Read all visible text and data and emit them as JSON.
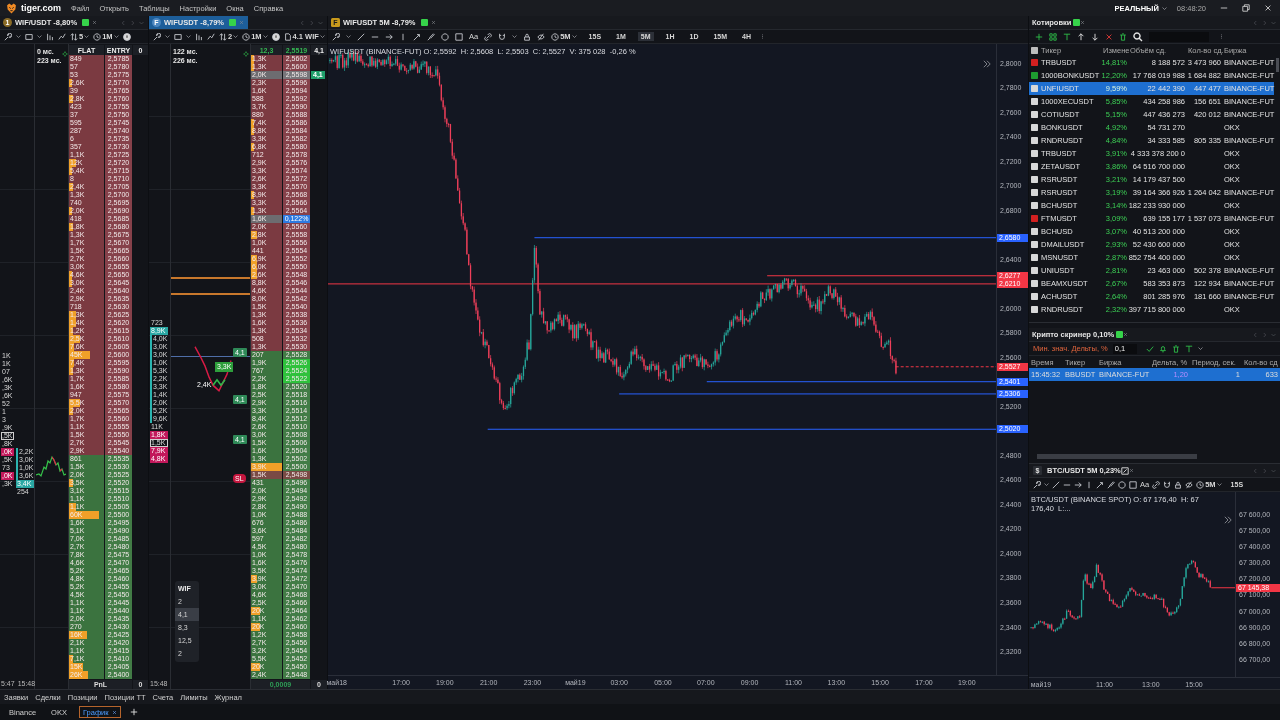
{
  "title_bar": {
    "brand": "tiger.com",
    "menu": [
      "Файл",
      "Открыть",
      "Таблицы",
      "Настройки",
      "Окна",
      "Справка"
    ],
    "account": "РЕАЛЬНЫЙ",
    "time": "08:48:20"
  },
  "order_books": [
    {
      "tab": {
        "badge": "1",
        "title": "WIF/USDT -8,80%",
        "selected": false
      },
      "toolbar": {
        "depth": "5",
        "interval": "1M"
      },
      "latency": [
        "0 мс.",
        "223 мс."
      ],
      "columns": [
        "FLAT",
        "ENTRY",
        "0"
      ],
      "side_lists": [
        {
          "items": [
            {
              "text": "1K",
              "kind": "plain"
            },
            {
              "text": "1K",
              "kind": "plain"
            },
            {
              "text": "07",
              "kind": "plain"
            },
            {
              "text": ",6K",
              "kind": "plain"
            },
            {
              "text": ",3K",
              "kind": "plain"
            },
            {
              "text": ",6K",
              "kind": "plain"
            },
            {
              "text": "52",
              "kind": "plain"
            },
            {
              "text": "1",
              "kind": "plain"
            },
            {
              "text": "3",
              "kind": "plain"
            },
            {
              "text": ",9K",
              "kind": "plain"
            },
            {
              "text": ",5K",
              "kind": "boxed"
            },
            {
              "text": ",8K",
              "kind": "plain"
            },
            {
              "text": ",0K",
              "kind": "sell"
            },
            {
              "text": ",5K",
              "kind": "plain"
            },
            {
              "text": "73",
              "kind": "plain"
            },
            {
              "text": ",0K",
              "kind": "sell"
            },
            {
              "text": ",3K",
              "kind": "plain"
            }
          ]
        },
        {
          "items": [
            {
              "text": "2,2K",
              "kind": "buy"
            },
            {
              "text": "3,0K",
              "kind": "buy"
            },
            {
              "text": "1,0K",
              "kind": "buy"
            },
            {
              "text": "3,6K",
              "kind": "buy"
            },
            {
              "text": "3,4K",
              "kind": "hit"
            }
          ],
          "footer": "254"
        }
      ],
      "rows": [
        {
          "kind": "ask",
          "volume": "849",
          "price": "2,5785"
        },
        {
          "kind": "ask",
          "volume": "57",
          "price": "2,5780"
        },
        {
          "kind": "ask",
          "volume": "53",
          "price": "2,5775"
        },
        {
          "kind": "ask",
          "volume": "2,6K",
          "price": "2,5770",
          "level": 0.08
        },
        {
          "kind": "ask",
          "volume": "39",
          "price": "2,5765"
        },
        {
          "kind": "ask",
          "volume": "2,8K",
          "price": "2,5760",
          "level": 0.12
        },
        {
          "kind": "ask",
          "volume": "423",
          "price": "2,5755"
        },
        {
          "kind": "ask",
          "volume": "37",
          "price": "2,5750"
        },
        {
          "kind": "ask",
          "volume": "595",
          "price": "2,5745"
        },
        {
          "kind": "ask",
          "volume": "287",
          "price": "2,5740"
        },
        {
          "kind": "ask",
          "volume": "6",
          "price": "2,5735"
        },
        {
          "kind": "ask",
          "volume": "357",
          "price": "2,5730"
        },
        {
          "kind": "ask",
          "volume": "1,1K",
          "price": "2,5725"
        },
        {
          "kind": "ask",
          "volume": "12K",
          "price": "2,5720",
          "level": 0.2
        },
        {
          "kind": "ask",
          "volume": "5,4K",
          "price": "2,5715",
          "level": 0.08
        },
        {
          "kind": "ask",
          "volume": "8",
          "price": "2,5710"
        },
        {
          "kind": "ask",
          "volume": "2,4K",
          "price": "2,5705",
          "level": 0.1
        },
        {
          "kind": "ask",
          "volume": "1,3K",
          "price": "2,5700"
        },
        {
          "kind": "ask",
          "volume": "740",
          "price": "2,5695"
        },
        {
          "kind": "ask",
          "volume": "2,0K",
          "price": "2,5690",
          "level": 0.08
        },
        {
          "kind": "ask",
          "volume": "418",
          "price": "2,5685"
        },
        {
          "kind": "ask",
          "volume": "1,8K",
          "price": "2,5680",
          "level": 0.1
        },
        {
          "kind": "ask",
          "volume": "1,3K",
          "price": "2,5675"
        },
        {
          "kind": "ask",
          "volume": "1,7K",
          "price": "2,5670"
        },
        {
          "kind": "ask",
          "volume": "1,5K",
          "price": "2,5665"
        },
        {
          "kind": "ask",
          "volume": "2,7K",
          "price": "2,5660"
        },
        {
          "kind": "ask",
          "volume": "3,0K",
          "price": "2,5655"
        },
        {
          "kind": "ask",
          "volume": "4,6K",
          "price": "2,5650",
          "level": 0.08
        },
        {
          "kind": "ask",
          "volume": "3,0K",
          "price": "2,5645",
          "level": 0.08
        },
        {
          "kind": "ask",
          "volume": "2,4K",
          "price": "2,5640"
        },
        {
          "kind": "ask",
          "volume": "2,9K",
          "price": "2,5635"
        },
        {
          "kind": "ask",
          "volume": "718",
          "price": "2,5630"
        },
        {
          "kind": "ask",
          "volume": "1,3K",
          "price": "2,5625",
          "level": 0.2
        },
        {
          "kind": "ask",
          "volume": "1,4K",
          "price": "2,5620",
          "level": 0.2
        },
        {
          "kind": "ask",
          "volume": "1,2K",
          "price": "2,5615",
          "level": 0.1
        },
        {
          "kind": "ask",
          "volume": "2,5K",
          "price": "2,5610",
          "level": 0.3
        },
        {
          "kind": "ask",
          "volume": "7,6K",
          "price": "2,5605",
          "level": 0.15
        },
        {
          "kind": "ask",
          "volume": "45K",
          "price": "2,5600",
          "level": 0.6
        },
        {
          "kind": "ask",
          "volume": "7,4K",
          "price": "2,5595",
          "level": 0.15
        },
        {
          "kind": "ask",
          "volume": "1,3K",
          "price": "2,5590",
          "level": 0.1
        },
        {
          "kind": "ask",
          "volume": "1,7K",
          "price": "2,5585"
        },
        {
          "kind": "ask",
          "volume": "1,6K",
          "price": "2,5580"
        },
        {
          "kind": "ask",
          "volume": "947",
          "price": "2,5575"
        },
        {
          "kind": "ask",
          "volume": "5,5K",
          "price": "2,5570",
          "level": 0.3
        },
        {
          "kind": "ask",
          "volume": "2,0K",
          "price": "2,5565",
          "level": 0.1
        },
        {
          "kind": "ask",
          "volume": "1,7K",
          "price": "2,5560"
        },
        {
          "kind": "ask",
          "volume": "1,1K",
          "price": "2,5555"
        },
        {
          "kind": "ask",
          "volume": "1,5K",
          "price": "2,5550"
        },
        {
          "kind": "ask",
          "volume": "2,7K",
          "price": "2,5545"
        },
        {
          "kind": "ask",
          "volume": "2,9K",
          "price": "2,5540"
        },
        {
          "kind": "bid",
          "volume": "861",
          "price": "2,5535"
        },
        {
          "kind": "bid",
          "volume": "1,5K",
          "price": "2,5530"
        },
        {
          "kind": "bid",
          "volume": "2,0K",
          "price": "2,5525"
        },
        {
          "kind": "bid",
          "volume": "3,5K",
          "price": "2,5520",
          "level": 0.1
        },
        {
          "kind": "bid",
          "volume": "3,1K",
          "price": "2,5515"
        },
        {
          "kind": "bid",
          "volume": "1,1K",
          "price": "2,5510"
        },
        {
          "kind": "bid",
          "volume": "1,1K",
          "price": "2,5505",
          "level": 0.2
        },
        {
          "kind": "bid",
          "volume": "60K",
          "price": "2,5500",
          "level": 0.85
        },
        {
          "kind": "bid",
          "volume": "1,6K",
          "price": "2,5495"
        },
        {
          "kind": "bid",
          "volume": "5,1K",
          "price": "2,5490"
        },
        {
          "kind": "bid",
          "volume": "7,0K",
          "price": "2,5485"
        },
        {
          "kind": "bid",
          "volume": "2,7K",
          "price": "2,5480"
        },
        {
          "kind": "bid",
          "volume": "7,8K",
          "price": "2,5475"
        },
        {
          "kind": "bid",
          "volume": "4,6K",
          "price": "2,5470"
        },
        {
          "kind": "bid",
          "volume": "5,2K",
          "price": "2,5465"
        },
        {
          "kind": "bid",
          "volume": "4,8K",
          "price": "2,5460"
        },
        {
          "kind": "bid",
          "volume": "5,2K",
          "price": "2,5455"
        },
        {
          "kind": "bid",
          "volume": "4,5K",
          "price": "2,5450"
        },
        {
          "kind": "bid",
          "volume": "1,1K",
          "price": "2,5445"
        },
        {
          "kind": "bid",
          "volume": "1,1K",
          "price": "2,5440"
        },
        {
          "kind": "bid",
          "volume": "2,0K",
          "price": "2,5435"
        },
        {
          "kind": "bid",
          "volume": "270",
          "price": "2,5430"
        },
        {
          "kind": "bid",
          "volume": "16K",
          "price": "2,5425",
          "level": 0.5
        },
        {
          "kind": "bid",
          "volume": "2,1K",
          "price": "2,5420"
        },
        {
          "kind": "bid",
          "volume": "1,1K",
          "price": "2,5415"
        },
        {
          "kind": "bid",
          "volume": "7,1K",
          "price": "2,5410",
          "level": 0.1
        },
        {
          "kind": "bid",
          "volume": "15K",
          "price": "2,5405",
          "level": 0.4
        },
        {
          "kind": "bid",
          "volume": "26K",
          "price": "2,5400",
          "level": 0.55
        }
      ],
      "footer": {
        "times": [
          "5:47",
          "15:48"
        ],
        "cells": [
          "PnL",
          "0"
        ]
      }
    },
    {
      "tab": {
        "badge": "F",
        "title": "WIFUSDT -8,79%",
        "selected": true
      },
      "toolbar": {
        "depth": "2",
        "interval": "1M",
        "volume": "4.1 WIF"
      },
      "latency": [
        "122 мс.",
        "226 мс."
      ],
      "columns": [
        "12,3",
        "2,5519",
        "4,1"
      ],
      "side_lists": [
        {
          "items": [
            {
              "text": "723",
              "kind": "plain"
            },
            {
              "text": "8,9K",
              "kind": "hit"
            },
            {
              "text": "4,0K",
              "kind": "buy"
            },
            {
              "text": "3,0K",
              "kind": "buy"
            },
            {
              "text": "3,0K",
              "kind": "buy"
            },
            {
              "text": "1,0K",
              "kind": "buy"
            },
            {
              "text": "5,3K",
              "kind": "buy"
            },
            {
              "text": "2,2K",
              "kind": "buy"
            },
            {
              "text": "3,3K",
              "kind": "buy"
            },
            {
              "text": "1,4K",
              "kind": "buy"
            },
            {
              "text": "2,0K",
              "kind": "buy"
            },
            {
              "text": "5,2K",
              "kind": "buy"
            },
            {
              "text": "9,6K",
              "kind": "buy"
            },
            {
              "text": "11K",
              "kind": "plain"
            },
            {
              "text": "1,8K",
              "kind": "sell"
            },
            {
              "text": "1,5K",
              "kind": "boxed"
            },
            {
              "text": "7,9K",
              "kind": "sell"
            },
            {
              "text": "4,8K",
              "kind": "sell"
            }
          ]
        }
      ],
      "markers": [
        {
          "text": "4,1",
          "kind": "buy"
        },
        {
          "text": "4,1",
          "kind": "buy"
        },
        {
          "text": "4,1",
          "kind": "buy"
        },
        {
          "text": "SL",
          "kind": "stop"
        }
      ],
      "cluster": [
        {
          "text": "3,3K",
          "kind": "buy"
        },
        {
          "text": "2,4K",
          "kind": "sell"
        }
      ],
      "quick_volumes": {
        "title": "WIF",
        "values": [
          {
            "label": "2",
            "selected": false
          },
          {
            "label": "4,1",
            "selected": true
          },
          {
            "label": "8,3",
            "selected": false
          },
          {
            "label": "12,5",
            "selected": false
          },
          {
            "label": "2",
            "selected": false
          }
        ]
      },
      "rows": [
        {
          "kind": "ask",
          "volume": "1,3K",
          "price": "2,5602",
          "level": 0.1
        },
        {
          "kind": "ask",
          "volume": "1,3K",
          "price": "2,5600",
          "level": 0.1
        },
        {
          "kind": "ask",
          "volume": "2,0K",
          "price": "2,5598",
          "order": "4,1"
        },
        {
          "kind": "ask",
          "volume": "2,3K",
          "price": "2,5596"
        },
        {
          "kind": "ask",
          "volume": "1,6K",
          "price": "2,5594"
        },
        {
          "kind": "ask",
          "volume": "588",
          "price": "2,5592"
        },
        {
          "kind": "ask",
          "volume": "3,7K",
          "price": "2,5590"
        },
        {
          "kind": "ask",
          "volume": "880",
          "price": "2,5588"
        },
        {
          "kind": "ask",
          "volume": "7,4K",
          "price": "2,5586",
          "level": 0.1
        },
        {
          "kind": "ask",
          "volume": "8,8K",
          "price": "2,5584",
          "level": 0.1
        },
        {
          "kind": "ask",
          "volume": "3,3K",
          "price": "2,5582"
        },
        {
          "kind": "ask",
          "volume": "6,8K",
          "price": "2,5580",
          "level": 0.1
        },
        {
          "kind": "ask",
          "volume": "712",
          "price": "2,5578"
        },
        {
          "kind": "ask",
          "volume": "2,9K",
          "price": "2,5576"
        },
        {
          "kind": "ask",
          "volume": "3,3K",
          "price": "2,5574"
        },
        {
          "kind": "ask",
          "volume": "2,6K",
          "price": "2,5572"
        },
        {
          "kind": "ask",
          "volume": "3,3K",
          "price": "2,5570"
        },
        {
          "kind": "ask",
          "volume": "8,9K",
          "price": "2,5568",
          "level": 0.1
        },
        {
          "kind": "ask",
          "volume": "3,3K",
          "price": "2,5566"
        },
        {
          "kind": "ask",
          "volume": "1,3K",
          "price": "2,5564",
          "level": 0.1
        },
        {
          "kind": "ask",
          "volume": "1,6K",
          "tooltip": "0,122%"
        },
        {
          "kind": "ask",
          "volume": "2,0K",
          "price": "2,5560"
        },
        {
          "kind": "ask",
          "volume": "2,8K",
          "price": "2,5558",
          "level": 0.2
        },
        {
          "kind": "ask",
          "volume": "1,0K",
          "price": "2,5556"
        },
        {
          "kind": "ask",
          "volume": "441",
          "price": "2,5554"
        },
        {
          "kind": "ask",
          "volume": "6,9K",
          "price": "2,5552",
          "level": 0.2
        },
        {
          "kind": "ask",
          "volume": "6,0K",
          "price": "2,5550",
          "level": 0.2
        },
        {
          "kind": "ask",
          "volume": "2,6K",
          "price": "2,5548",
          "level": 0.2
        },
        {
          "kind": "ask",
          "volume": "8,8K",
          "price": "2,5546"
        },
        {
          "kind": "ask",
          "volume": "4,6K",
          "price": "2,5544"
        },
        {
          "kind": "ask",
          "volume": "8,0K",
          "price": "2,5542"
        },
        {
          "kind": "ask",
          "volume": "1,5K",
          "price": "2,5540"
        },
        {
          "kind": "ask",
          "volume": "1,3K",
          "price": "2,5538"
        },
        {
          "kind": "ask",
          "volume": "1,6K",
          "price": "2,5536"
        },
        {
          "kind": "ask",
          "volume": "1,3K",
          "price": "2,5534"
        },
        {
          "kind": "ask",
          "volume": "508",
          "price": "2,5532"
        },
        {
          "kind": "ask",
          "volume": "1,3K",
          "price": "2,5530"
        },
        {
          "kind": "bid",
          "volume": "207",
          "price": "2,5528"
        },
        {
          "kind": "trade",
          "volume": "1,9K",
          "price": "2,5526"
        },
        {
          "kind": "trade",
          "volume": "767",
          "price": "2,5524"
        },
        {
          "kind": "trade",
          "volume": "2,2K",
          "price": "2,5522"
        },
        {
          "kind": "bid",
          "volume": "1,8K",
          "price": "2,5520"
        },
        {
          "kind": "bid",
          "volume": "2,5K",
          "price": "2,5518"
        },
        {
          "kind": "bid",
          "volume": "2,9K",
          "price": "2,5516"
        },
        {
          "kind": "bid",
          "volume": "3,3K",
          "price": "2,5514"
        },
        {
          "kind": "bid",
          "volume": "8,4K",
          "price": "2,5512"
        },
        {
          "kind": "bid",
          "volume": "2,6K",
          "price": "2,5510"
        },
        {
          "kind": "bid",
          "volume": "3,0K",
          "price": "2,5508"
        },
        {
          "kind": "bid",
          "volume": "1,5K",
          "price": "2,5506"
        },
        {
          "kind": "bid",
          "volume": "1,6K",
          "price": "2,5504"
        },
        {
          "kind": "bid",
          "volume": "1,3K",
          "price": "2,5502"
        },
        {
          "kind": "bid",
          "volume": "3,9K",
          "price": "2,5500",
          "level": 1
        },
        {
          "kind": "stop",
          "volume": "1,5K",
          "price": "2,5498"
        },
        {
          "kind": "bid",
          "volume": "431",
          "price": "2,5496"
        },
        {
          "kind": "bid",
          "volume": "2,0K",
          "price": "2,5494"
        },
        {
          "kind": "bid",
          "volume": "2,9K",
          "price": "2,5492"
        },
        {
          "kind": "bid",
          "volume": "2,8K",
          "price": "2,5490"
        },
        {
          "kind": "bid",
          "volume": "1,0K",
          "price": "2,5488"
        },
        {
          "kind": "bid",
          "volume": "676",
          "price": "2,5486"
        },
        {
          "kind": "bid",
          "volume": "3,6K",
          "price": "2,5484"
        },
        {
          "kind": "bid",
          "volume": "597",
          "price": "2,5482"
        },
        {
          "kind": "bid",
          "volume": "4,5K",
          "price": "2,5480"
        },
        {
          "kind": "bid",
          "volume": "1,0K",
          "price": "2,5478"
        },
        {
          "kind": "bid",
          "volume": "1,6K",
          "price": "2,5476"
        },
        {
          "kind": "bid",
          "volume": "3,5K",
          "price": "2,5474"
        },
        {
          "kind": "bid",
          "volume": "3,9K",
          "price": "2,5472",
          "level": 0.2
        },
        {
          "kind": "bid",
          "volume": "3,0K",
          "price": "2,5470"
        },
        {
          "kind": "bid",
          "volume": "4,6K",
          "price": "2,5468"
        },
        {
          "kind": "bid",
          "volume": "2,5K",
          "price": "2,5466"
        },
        {
          "kind": "bid",
          "volume": "20K",
          "price": "2,5464",
          "level": 0.3
        },
        {
          "kind": "bid",
          "volume": "1,1K",
          "price": "2,5462"
        },
        {
          "kind": "bid",
          "volume": "20K",
          "price": "2,5460",
          "level": 0.3
        },
        {
          "kind": "bid",
          "volume": "1,2K",
          "price": "2,5458"
        },
        {
          "kind": "bid",
          "volume": "2,7K",
          "price": "2,5456"
        },
        {
          "kind": "bid",
          "volume": "3,2K",
          "price": "2,5454"
        },
        {
          "kind": "bid",
          "volume": "5,5K",
          "price": "2,5452"
        },
        {
          "kind": "bid",
          "volume": "20K",
          "price": "2,5450",
          "level": 0.3
        },
        {
          "kind": "bid",
          "volume": "2,4K",
          "price": "2,5448"
        }
      ],
      "footer": {
        "times": [
          "15:48"
        ],
        "cells": [
          "0,0009",
          "0"
        ]
      }
    }
  ],
  "chart": {
    "tab": {
      "badge": "F",
      "title": "WIFUSDT 5M -8,79%"
    },
    "toolbar": {
      "text_tool": "Aa",
      "interval": "5M",
      "timeframes": [
        {
          "label": "15S",
          "selected": false
        },
        {
          "label": "1M",
          "selected": false
        },
        {
          "label": "5M",
          "selected": true
        },
        {
          "label": "1H",
          "selected": false
        },
        {
          "label": "1D",
          "selected": false
        },
        {
          "label": "15M",
          "selected": false
        },
        {
          "label": "4H",
          "selected": false
        }
      ]
    },
    "legend": "WIFUSDT (BINANCE-FUT) O: 2,5592  H: 2,5608  L: 2,5503  C: 2,5527  V: 375 028  -0,26 %",
    "price_axis": [
      "2,8000",
      "2,7800",
      "2,7600",
      "2,7400",
      "2,7200",
      "2,7000",
      "2,6800",
      "2,6400",
      "2,6000",
      "2,5800",
      "2,5600",
      "2,5200",
      "2,4800",
      "2,4600",
      "2,4400",
      "2,4200",
      "2,4000",
      "2,3800",
      "2,3600",
      "2,3400",
      "2,3200"
    ],
    "price_tags": [
      {
        "label": "2,6580",
        "color": "#2962ff"
      },
      {
        "label": "2,6277",
        "color": "#f23645"
      },
      {
        "label": "2,6210",
        "color": "#f23645"
      },
      {
        "label": "2,5527",
        "color": "#f23645"
      },
      {
        "label": "2,5401",
        "color": "#2962ff"
      },
      {
        "label": "2,5306",
        "color": "#2962ff"
      },
      {
        "label": "2,5020",
        "color": "#2962ff"
      }
    ],
    "time_axis": [
      "май18",
      "17:00",
      "19:00",
      "21:00",
      "23:00",
      "май19",
      "03:00",
      "05:00",
      "07:00",
      "09:00",
      "11:00",
      "13:00",
      "15:00",
      "17:00",
      "19:00"
    ]
  },
  "quotes": {
    "title": "Котировки",
    "columns": [
      "Тикер",
      "Измене",
      "Объём сд.",
      "Кол-во сд.",
      "Биржа"
    ],
    "rows": [
      {
        "color": "#d32020",
        "ticker": "TRBUSDT",
        "change": "14,81%",
        "volume": "8 188 572",
        "trades": "3 473 960",
        "exchange": "BINANCE-FUT",
        "selected": false
      },
      {
        "color": "#1e9e30",
        "ticker": "1000BONKUSDT",
        "change": "12,20%",
        "volume": "17 768 019 988",
        "trades": "1 684 882",
        "exchange": "BINANCE-FUT",
        "selected": false
      },
      {
        "color": "#d8d8d8",
        "ticker": "UNFIUSDT",
        "change": "9,59%",
        "volume": "22 442 390",
        "trades": "447 477",
        "exchange": "BINANCE-FUT",
        "selected": true
      },
      {
        "color": "#d8d8d8",
        "ticker": "1000XECUSDT",
        "change": "5,85%",
        "volume": "434 258 986",
        "trades": "156 651",
        "exchange": "BINANCE-FUT",
        "selected": false
      },
      {
        "color": "#d8d8d8",
        "ticker": "COTIUSDT",
        "change": "5,15%",
        "volume": "447 436 273",
        "trades": "420 012",
        "exchange": "BINANCE-FUT",
        "selected": false
      },
      {
        "color": "#d8d8d8",
        "ticker": "BONKUSDT",
        "change": "4,92%",
        "volume": "54 731 270",
        "exchange": "OKX",
        "selected": false
      },
      {
        "color": "#d8d8d8",
        "ticker": "RNDRUSDT",
        "change": "4,84%",
        "volume": "34 333 585",
        "trades": "805 335",
        "exchange": "BINANCE-FUT",
        "selected": false
      },
      {
        "color": "#d8d8d8",
        "ticker": "TRBUSDT",
        "change": "3,91%",
        "volume": "4 333 378 200 0",
        "exchange": "OKX",
        "selected": false
      },
      {
        "color": "#d8d8d8",
        "ticker": "ZETAUSDT",
        "change": "3,86%",
        "volume": "64 516 700 000",
        "exchange": "OKX",
        "selected": false
      },
      {
        "color": "#d8d8d8",
        "ticker": "RSRUSDT",
        "change": "3,21%",
        "volume": "14 179 437 500",
        "exchange": "OKX",
        "selected": false
      },
      {
        "color": "#d8d8d8",
        "ticker": "RSRUSDT",
        "change": "3,19%",
        "volume": "39 164 366 926",
        "trades": "1 264 042",
        "exchange": "BINANCE-FUT",
        "selected": false
      },
      {
        "color": "#d8d8d8",
        "ticker": "BCHUSDT",
        "change": "3,14%",
        "volume": "182 233 930 000",
        "exchange": "OKX",
        "selected": false
      },
      {
        "color": "#d32020",
        "ticker": "FTMUSDT",
        "change": "3,09%",
        "volume": "639 155 177",
        "trades": "1 537 073",
        "exchange": "BINANCE-FUT",
        "selected": false
      },
      {
        "color": "#d8d8d8",
        "ticker": "BCHUSD",
        "change": "3,07%",
        "volume": "40 513 200 000",
        "exchange": "OKX",
        "selected": false
      },
      {
        "color": "#d8d8d8",
        "ticker": "DMAILUSDT",
        "change": "2,93%",
        "volume": "52 430 600 000",
        "exchange": "OKX",
        "selected": false
      },
      {
        "color": "#d8d8d8",
        "ticker": "MSNUSDT",
        "change": "2,87%",
        "volume": "852 754 400 000",
        "exchange": "OKX",
        "selected": false
      },
      {
        "color": "#d8d8d8",
        "ticker": "UNIUSDT",
        "change": "2,81%",
        "volume": "23 463 000",
        "trades": "502 378",
        "exchange": "BINANCE-FUT",
        "selected": false
      },
      {
        "color": "#d8d8d8",
        "ticker": "BEAMXUSDT",
        "change": "2,67%",
        "volume": "583 353 873",
        "trades": "122 934",
        "exchange": "BINANCE-FUT",
        "selected": false
      },
      {
        "color": "#d8d8d8",
        "ticker": "ACHUSDT",
        "change": "2,64%",
        "volume": "801 285 976",
        "trades": "181 660",
        "exchange": "BINANCE-FUT",
        "selected": false
      },
      {
        "color": "#d8d8d8",
        "ticker": "RNDRUSDT",
        "change": "2,32%",
        "volume": "397 715 800 000",
        "exchange": "OKX",
        "selected": false
      }
    ]
  },
  "screener": {
    "title": "Крипто скринер 0,10%",
    "filter_label": "Мин. знач. Дельты, %",
    "filter_value": "0,1",
    "columns": [
      "Время",
      "Тикер",
      "Биржа",
      "Дельта, %",
      "Период, сек.",
      "Кол-во сд"
    ],
    "rows": [
      {
        "time": "15:45:32",
        "ticker": "BBUSDT",
        "exchange": "BINANCE-FUT",
        "delta": "1,20",
        "period": "1",
        "count": "633",
        "selected": true
      }
    ]
  },
  "btc_chart": {
    "tab": {
      "badge": "$",
      "title": "BTC/USDT 5M 0,23%"
    },
    "toolbar": {
      "text_tool": "Aa",
      "interval": "5M",
      "timeframes": [
        {
          "label": "15S",
          "selected": false
        }
      ]
    },
    "legend": "BTC/USDT (BINANCE SPOT) O: 67 176,40  H: 67 176,40  L:...",
    "price_axis": [
      "67 600,00",
      "67 500,00",
      "67 400,00",
      "67 300,00",
      "67 200,00",
      "67 100,00",
      "67 000,00",
      "66 900,00",
      "66 800,00",
      "66 700,00"
    ],
    "price_tag": {
      "label": "67 145,38",
      "color": "#f23645"
    },
    "time_axis": [
      "май19",
      "11:00",
      "13:00",
      "15:00"
    ]
  },
  "bottom_tabs": [
    "Заявки",
    "Сделки",
    "Позиции",
    "Позиции ТТ",
    "Счета",
    "Лимиты",
    "Журнал"
  ],
  "workspace_tabs": [
    {
      "label": "Binance",
      "selected": false
    },
    {
      "label": "OKX",
      "selected": false
    },
    {
      "label": "График",
      "selected": true
    }
  ]
}
